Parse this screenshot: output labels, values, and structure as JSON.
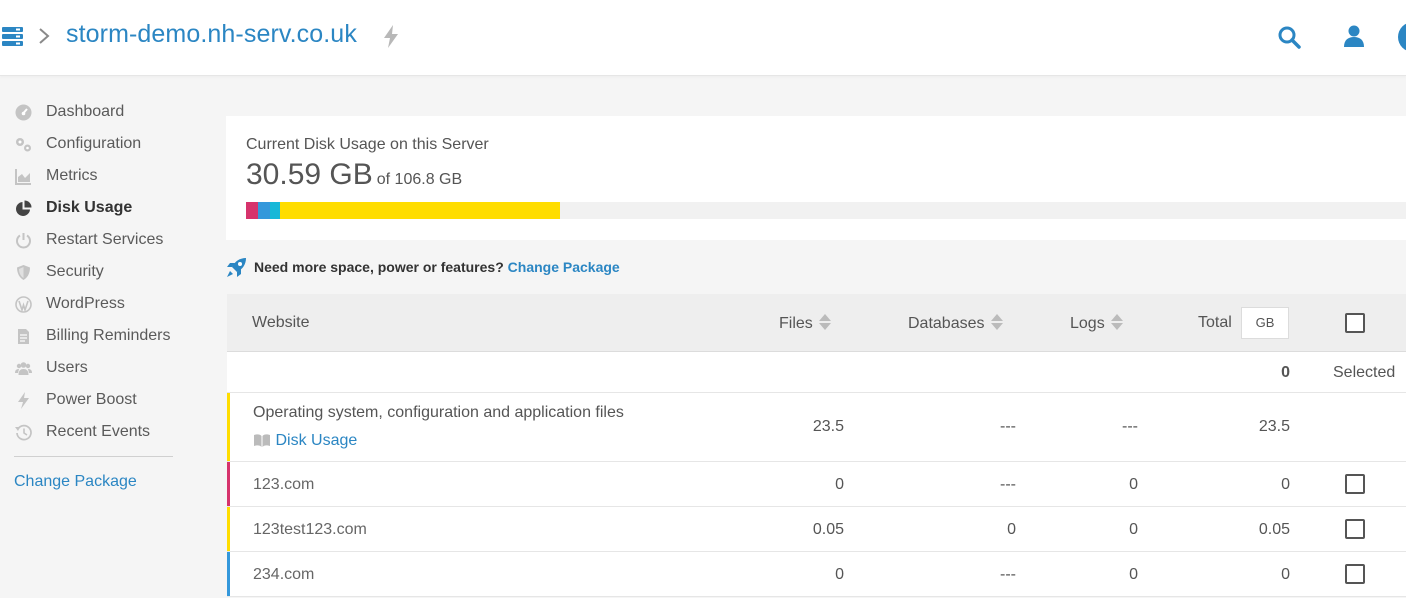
{
  "header": {
    "server_name": "storm-demo.nh-serv.co.uk"
  },
  "sidebar": {
    "items": [
      {
        "label": "Dashboard",
        "icon": "dashboard-icon"
      },
      {
        "label": "Configuration",
        "icon": "gears-icon"
      },
      {
        "label": "Metrics",
        "icon": "chart-area-icon"
      },
      {
        "label": "Disk Usage",
        "icon": "pie-chart-icon",
        "active": true
      },
      {
        "label": "Restart Services",
        "icon": "power-icon"
      },
      {
        "label": "Security",
        "icon": "shield-icon"
      },
      {
        "label": "WordPress",
        "icon": "wordpress-icon"
      },
      {
        "label": "Billing Reminders",
        "icon": "invoice-icon"
      },
      {
        "label": "Users",
        "icon": "users-icon"
      },
      {
        "label": "Power Boost",
        "icon": "bolt-icon"
      },
      {
        "label": "Recent Events",
        "icon": "history-icon"
      }
    ],
    "change_package": "Change Package"
  },
  "usage": {
    "title": "Current Disk Usage on this Server",
    "used": "30.59 GB",
    "total": "of 106.8 GB",
    "used_gb": 30.59,
    "total_gb": 106.8,
    "segments": [
      {
        "color": "#d6336c",
        "fraction": 0.0105
      },
      {
        "color": "#3498db",
        "fraction": 0.0107
      },
      {
        "color": "#17b8d8",
        "fraction": 0.0089
      },
      {
        "color": "#ffdd00",
        "fraction": 0.241
      }
    ]
  },
  "upsell": {
    "text": "Need more space, power or features?",
    "link": "Change Package"
  },
  "table": {
    "headers": {
      "website": "Website",
      "files": "Files",
      "databases": "Databases",
      "logs": "Logs",
      "total": "Total",
      "unit": "GB"
    },
    "selected_count": "0",
    "selected_label": "Selected",
    "system_row": {
      "title": "Operating system, configuration and application files",
      "link": "Disk Usage",
      "files": "23.5",
      "databases": "---",
      "logs": "---",
      "total": "23.5",
      "accent": "#ffdd00"
    },
    "rows": [
      {
        "site": "123.com",
        "files": "0",
        "databases": "---",
        "logs": "0",
        "total": "0",
        "accent": "#d6336c"
      },
      {
        "site": "123test123.com",
        "files": "0.05",
        "databases": "0",
        "logs": "0",
        "total": "0.05",
        "accent": "#ffdd00"
      },
      {
        "site": "234.com",
        "files": "0",
        "databases": "---",
        "logs": "0",
        "total": "0",
        "accent": "#3498db"
      }
    ]
  },
  "colors": {
    "accent": "#2b86c3",
    "sidebar_icon": "#c4c4c4"
  }
}
